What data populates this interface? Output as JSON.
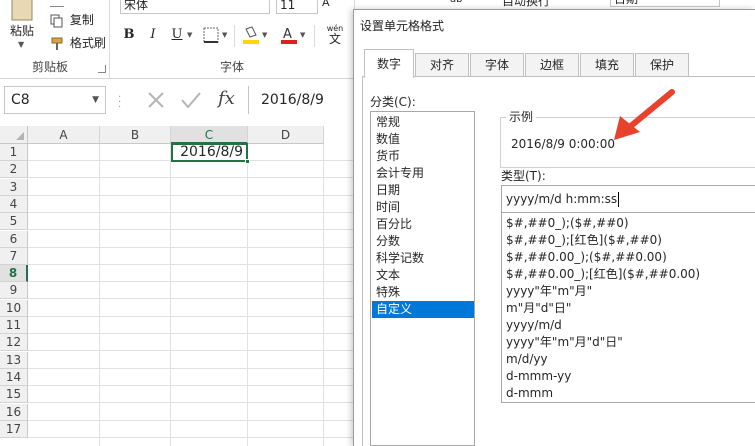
{
  "ribbon": {
    "paste_label": "粘贴",
    "copy_label": "复制",
    "format_painter_label": "格式刷",
    "clipboard_group": "剪贴板",
    "font_name": "宋体",
    "font_size": "11",
    "bold": "B",
    "italic": "I",
    "underline": "U",
    "font_group": "字体",
    "phonetic": "wén",
    "wrap_text": "自动换行",
    "number_format": "日期"
  },
  "formula_bar": {
    "name_box": "C8",
    "fx": "fx",
    "value": "2016/8/9"
  },
  "grid": {
    "columns": [
      "A",
      "B",
      "C",
      "D"
    ],
    "rows": [
      "1",
      "2",
      "3",
      "4",
      "5",
      "6",
      "7",
      "8",
      "9",
      "10",
      "11",
      "12",
      "13",
      "14",
      "15",
      "16",
      "17"
    ],
    "active_value": "2016/8/9"
  },
  "dialog": {
    "title": "设置单元格格式",
    "tabs": [
      "数字",
      "对齐",
      "字体",
      "边框",
      "填充",
      "保护"
    ],
    "category_label": "分类(C):",
    "categories": [
      "常规",
      "数值",
      "货币",
      "会计专用",
      "日期",
      "时间",
      "百分比",
      "分数",
      "科学记数",
      "文本",
      "特殊",
      "自定义"
    ],
    "sample_label": "示例",
    "sample_value": "2016/8/9 0:00:00",
    "type_label": "类型(T):",
    "type_value": "yyyy/m/d h:mm:ss",
    "formats": [
      "$#,##0_);($#,##0)",
      "$#,##0_);[红色]($#,##0)",
      "$#,##0.00_);($#,##0.00)",
      "$#,##0.00_);[红色]($#,##0.00)",
      "yyyy\"年\"m\"月\"",
      "m\"月\"d\"日\"",
      "yyyy/m/d",
      "yyyy\"年\"m\"月\"d\"日\"",
      "m/d/yy",
      "d-mmm-yy",
      "d-mmm"
    ]
  },
  "colors": {
    "excel_green": "#217346",
    "selection_blue": "#0078d7",
    "arrow_red": "#e8412c",
    "highlight_yellow": "#ffd700",
    "font_red": "#e01f1f"
  }
}
